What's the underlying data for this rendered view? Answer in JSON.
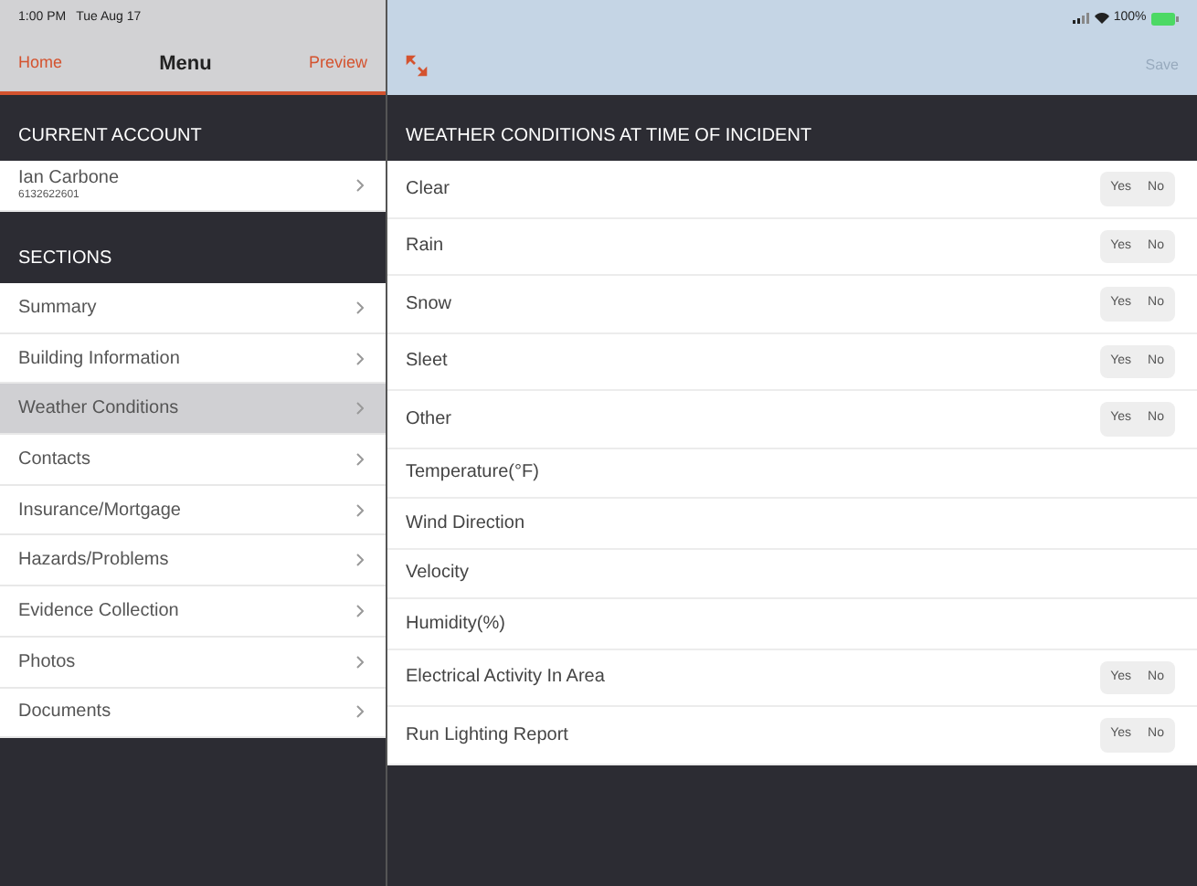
{
  "status_bar": {
    "time": "1:00 PM",
    "date": "Tue Aug 17",
    "battery": "100%"
  },
  "sidebar": {
    "nav": {
      "left": "Home",
      "title": "Menu",
      "right": "Preview"
    },
    "account_header": "CURRENT ACCOUNT",
    "account": {
      "name": "Ian Carbone",
      "number": "6132622601"
    },
    "sections_header": "SECTIONS",
    "items": [
      {
        "label": "Summary",
        "selected": false
      },
      {
        "label": "Building Information",
        "selected": false
      },
      {
        "label": "Weather Conditions",
        "selected": true
      },
      {
        "label": "Contacts",
        "selected": false
      },
      {
        "label": "Insurance/Mortgage",
        "selected": false
      },
      {
        "label": "Hazards/Problems",
        "selected": false
      },
      {
        "label": "Evidence Collection",
        "selected": false
      },
      {
        "label": "Photos",
        "selected": false
      },
      {
        "label": "Documents",
        "selected": false
      }
    ]
  },
  "main": {
    "save": "Save",
    "save_disabled": true,
    "header": "WEATHER CONDITIONS AT TIME OF INCIDENT",
    "rows": [
      {
        "kind": "toggle",
        "label": "Clear",
        "yes": "Yes",
        "no": "No"
      },
      {
        "kind": "toggle",
        "label": "Rain",
        "yes": "Yes",
        "no": "No"
      },
      {
        "kind": "toggle",
        "label": "Snow",
        "yes": "Yes",
        "no": "No"
      },
      {
        "kind": "toggle",
        "label": "Sleet",
        "yes": "Yes",
        "no": "No"
      },
      {
        "kind": "toggle",
        "label": "Other",
        "yes": "Yes",
        "no": "No"
      },
      {
        "kind": "text",
        "label": "Temperature(°F)"
      },
      {
        "kind": "text",
        "label": "Wind Direction"
      },
      {
        "kind": "text",
        "label": "Velocity"
      },
      {
        "kind": "text",
        "label": "Humidity(%)"
      },
      {
        "kind": "toggle",
        "label": "Electrical Activity In Area",
        "yes": "Yes",
        "no": "No"
      },
      {
        "kind": "toggle",
        "label": "Run Lighting Report",
        "yes": "Yes",
        "no": "No"
      }
    ]
  }
}
